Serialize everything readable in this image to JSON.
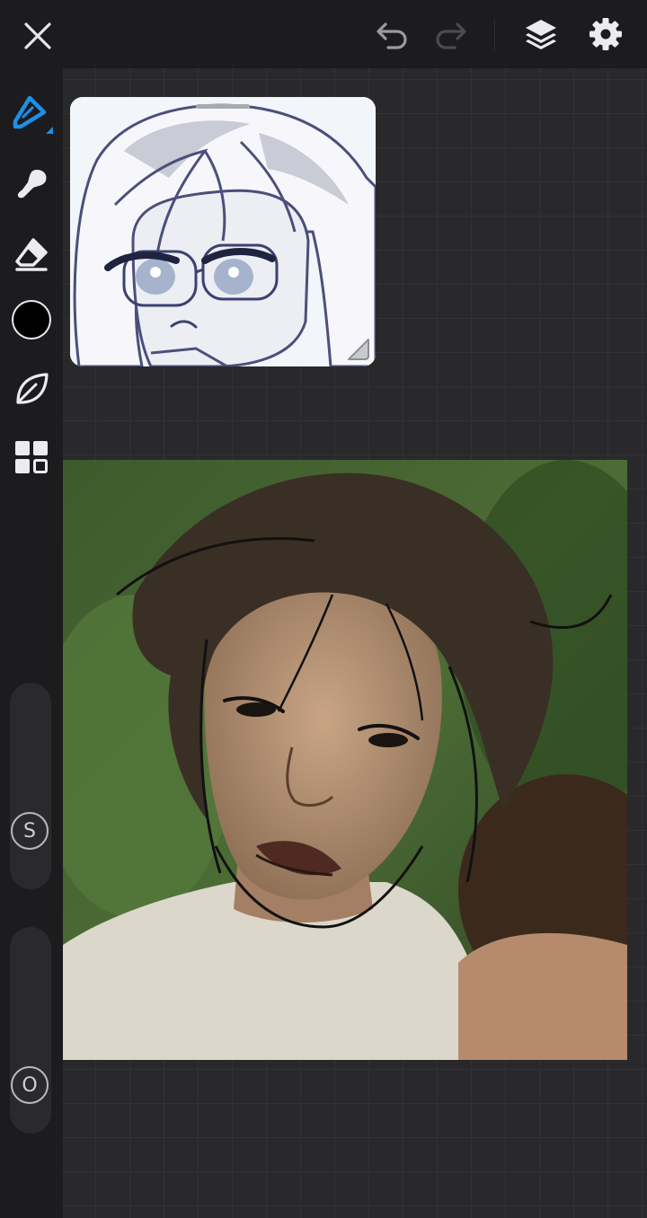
{
  "app": {
    "top_bar": {
      "close_icon": "close-icon",
      "undo_icon": "undo-icon",
      "redo_icon": "redo-icon",
      "layers_icon": "layers-icon",
      "settings_icon": "settings-icon"
    },
    "tools": [
      {
        "name": "pen-tool",
        "icon": "pen-icon",
        "active": true
      },
      {
        "name": "smudge-tool",
        "icon": "smudge-brush-icon",
        "active": false
      },
      {
        "name": "eraser-tool",
        "icon": "eraser-icon",
        "active": false
      },
      {
        "name": "color-picker",
        "icon": "color-swatch",
        "active": false
      },
      {
        "name": "brush-library",
        "icon": "leaf-icon",
        "active": false
      },
      {
        "name": "grid-menu",
        "icon": "grid-icon",
        "active": false
      }
    ],
    "sliders": {
      "size_label": "S",
      "opacity_label": "O"
    },
    "colors": {
      "accent": "#1e8fe6",
      "current_color": "#000000",
      "toolbar_bg": "#1c1c1e",
      "canvas_bg": "#29292c"
    }
  }
}
